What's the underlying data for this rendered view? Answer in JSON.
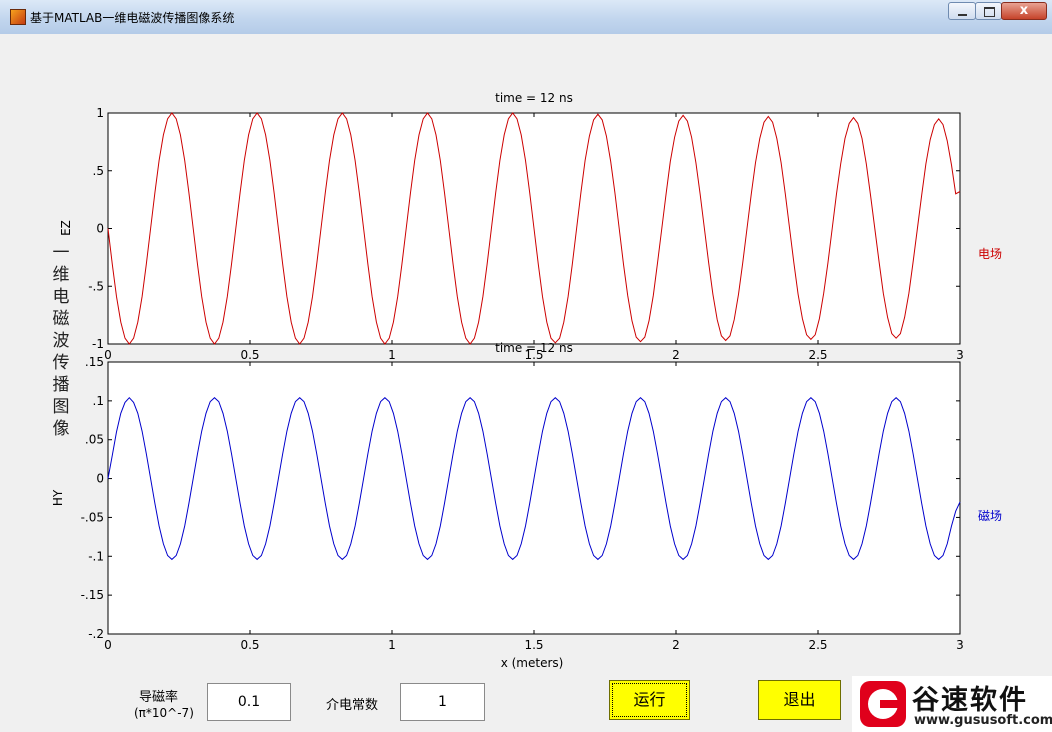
{
  "window": {
    "title": "基于MATLAB一维电磁波传播图像系统",
    "close_glyph": "x"
  },
  "side_title": "一维电磁波传播图像",
  "plots": {
    "ez": {
      "title": "time = 12 ns",
      "ylabel": "EZ",
      "legend_label": "电场",
      "color": "#cc0000"
    },
    "hy": {
      "title": "time = 12 ns",
      "ylabel": "HY",
      "legend_label": "磁场",
      "color": "#0000cc",
      "xlabel": "x (meters)"
    }
  },
  "controls": {
    "mu_label": "导磁率",
    "mu_unit": "(π*10^-7)",
    "mu_value": "0.1",
    "eps_label": "介电常数",
    "eps_value": "1",
    "run_label": "运行",
    "exit_label": "退出"
  },
  "watermark": {
    "name": "谷速软件",
    "url": "www.gususoft.com"
  },
  "chart_data": [
    {
      "type": "line",
      "title": "time = 12 ns",
      "ylabel": "EZ",
      "xlabel": "",
      "xlim": [
        0,
        3
      ],
      "ylim": [
        -1,
        1
      ],
      "xticks": [
        0,
        0.5,
        1,
        1.5,
        2,
        2.5,
        3
      ],
      "yticks": [
        -1,
        -0.5,
        0,
        0.5,
        1
      ],
      "grid": false,
      "legend_position": "right",
      "series": [
        {
          "name": "电场",
          "x": [
            0,
            0.015,
            0.03,
            0.045,
            0.06,
            0.075,
            0.09,
            0.105,
            0.12,
            0.135,
            0.15,
            0.165,
            0.18,
            0.195,
            0.21,
            0.225,
            0.24,
            0.255,
            0.27,
            0.285,
            0.3,
            0.315,
            0.33,
            0.345,
            0.36,
            0.375,
            0.39,
            0.405,
            0.42,
            0.435,
            0.45,
            0.465,
            0.48,
            0.495,
            0.51,
            0.525,
            0.54,
            0.555,
            0.57,
            0.585,
            0.6,
            0.615,
            0.63,
            0.645,
            0.66,
            0.675,
            0.69,
            0.705,
            0.72,
            0.735,
            0.75,
            0.765,
            0.78,
            0.795,
            0.81,
            0.825,
            0.84,
            0.855,
            0.87,
            0.885,
            0.9,
            0.915,
            0.93,
            0.945,
            0.96,
            0.975,
            0.99,
            1.005,
            1.02,
            1.035,
            1.05,
            1.065,
            1.08,
            1.095,
            1.11,
            1.125,
            1.14,
            1.155,
            1.17,
            1.185,
            1.2,
            1.215,
            1.23,
            1.245,
            1.26,
            1.275,
            1.29,
            1.305,
            1.32,
            1.335,
            1.35,
            1.365,
            1.38,
            1.395,
            1.41,
            1.425,
            1.44,
            1.455,
            1.47,
            1.485,
            1.5,
            1.515,
            1.53,
            1.545,
            1.56,
            1.575,
            1.59,
            1.605,
            1.62,
            1.635,
            1.65,
            1.665,
            1.68,
            1.695,
            1.71,
            1.725,
            1.74,
            1.755,
            1.77,
            1.785,
            1.8,
            1.815,
            1.83,
            1.845,
            1.86,
            1.875,
            1.89,
            1.905,
            1.92,
            1.935,
            1.95,
            1.965,
            1.98,
            1.995,
            2.01,
            2.025,
            2.04,
            2.055,
            2.07,
            2.085,
            2.1,
            2.115,
            2.13,
            2.145,
            2.16,
            2.175,
            2.19,
            2.205,
            2.22,
            2.235,
            2.25,
            2.265,
            2.28,
            2.295,
            2.31,
            2.325,
            2.34,
            2.355,
            2.37,
            2.385,
            2.4,
            2.415,
            2.43,
            2.445,
            2.46,
            2.475,
            2.49,
            2.505,
            2.52,
            2.535,
            2.55,
            2.565,
            2.58,
            2.595,
            2.61,
            2.625,
            2.64,
            2.655,
            2.67,
            2.685,
            2.7,
            2.715,
            2.73,
            2.745,
            2.76,
            2.775,
            2.79,
            2.805,
            2.82,
            2.835,
            2.85,
            2.865,
            2.88,
            2.895,
            2.91,
            2.925,
            2.94,
            2.955,
            2.97,
            2.985,
            3.0
          ],
          "values": [
            0.0,
            -0.31,
            -0.59,
            -0.81,
            -0.95,
            -1.0,
            -0.95,
            -0.81,
            -0.59,
            -0.31,
            0.0,
            0.31,
            0.59,
            0.81,
            0.95,
            1.0,
            0.95,
            0.81,
            0.59,
            0.31,
            0.0,
            -0.31,
            -0.59,
            -0.81,
            -0.95,
            -1.0,
            -0.95,
            -0.81,
            -0.59,
            -0.31,
            0.0,
            0.31,
            0.59,
            0.81,
            0.95,
            1.0,
            0.95,
            0.81,
            0.59,
            0.31,
            0.0,
            -0.31,
            -0.59,
            -0.81,
            -0.95,
            -1.0,
            -0.95,
            -0.81,
            -0.59,
            -0.31,
            0.0,
            0.31,
            0.59,
            0.81,
            0.95,
            1.0,
            0.95,
            0.81,
            0.59,
            0.31,
            0.0,
            -0.31,
            -0.59,
            -0.81,
            -0.95,
            -1.0,
            -0.95,
            -0.81,
            -0.59,
            -0.31,
            0.0,
            0.31,
            0.59,
            0.81,
            0.95,
            1.0,
            0.95,
            0.81,
            0.59,
            0.31,
            0.0,
            -0.31,
            -0.59,
            -0.81,
            -0.95,
            -1.0,
            -0.95,
            -0.81,
            -0.59,
            -0.31,
            0.0,
            0.31,
            0.59,
            0.81,
            0.95,
            1.0,
            0.95,
            0.81,
            0.59,
            0.31,
            0.0,
            -0.31,
            -0.59,
            -0.81,
            -0.95,
            -0.99,
            -0.95,
            -0.81,
            -0.59,
            -0.31,
            0.0,
            0.31,
            0.59,
            0.8,
            0.94,
            0.99,
            0.94,
            0.8,
            0.58,
            0.31,
            0.0,
            -0.31,
            -0.58,
            -0.8,
            -0.94,
            -0.98,
            -0.94,
            -0.8,
            -0.58,
            -0.3,
            0.0,
            0.3,
            0.58,
            0.79,
            0.93,
            0.98,
            0.93,
            0.79,
            0.57,
            0.3,
            0.0,
            -0.3,
            -0.57,
            -0.79,
            -0.93,
            -0.97,
            -0.93,
            -0.79,
            -0.57,
            -0.3,
            0.0,
            0.3,
            0.57,
            0.78,
            0.92,
            0.97,
            0.92,
            0.78,
            0.57,
            0.3,
            0.0,
            -0.3,
            -0.57,
            -0.78,
            -0.92,
            -0.96,
            -0.92,
            -0.78,
            -0.56,
            -0.3,
            0.0,
            0.3,
            0.56,
            0.78,
            0.91,
            0.96,
            0.91,
            0.78,
            0.56,
            0.29,
            0.0,
            -0.29,
            -0.56,
            -0.77,
            -0.91,
            -0.95,
            -0.91,
            -0.77,
            -0.56,
            -0.29,
            0.0,
            0.29,
            0.56,
            0.77,
            0.9,
            0.95,
            0.9,
            0.76,
            0.55,
            0.3,
            0.32
          ]
        }
      ]
    },
    {
      "type": "line",
      "title": "time = 12 ns",
      "ylabel": "HY",
      "xlabel": "x (meters)",
      "xlim": [
        0,
        3
      ],
      "ylim": [
        -0.2,
        0.15
      ],
      "xticks": [
        0,
        0.5,
        1,
        1.5,
        2,
        2.5,
        3
      ],
      "yticks": [
        -0.2,
        -0.15,
        -0.1,
        -0.05,
        0,
        0.05,
        0.1,
        0.15
      ],
      "grid": false,
      "legend_position": "right",
      "series": [
        {
          "name": "磁场",
          "x": [
            0,
            0.015,
            0.03,
            0.045,
            0.06,
            0.075,
            0.09,
            0.105,
            0.12,
            0.135,
            0.15,
            0.165,
            0.18,
            0.195,
            0.21,
            0.225,
            0.24,
            0.255,
            0.27,
            0.285,
            0.3,
            0.315,
            0.33,
            0.345,
            0.36,
            0.375,
            0.39,
            0.405,
            0.42,
            0.435,
            0.45,
            0.465,
            0.48,
            0.495,
            0.51,
            0.525,
            0.54,
            0.555,
            0.57,
            0.585,
            0.6,
            0.615,
            0.63,
            0.645,
            0.66,
            0.675,
            0.69,
            0.705,
            0.72,
            0.735,
            0.75,
            0.765,
            0.78,
            0.795,
            0.81,
            0.825,
            0.84,
            0.855,
            0.87,
            0.885,
            0.9,
            0.915,
            0.93,
            0.945,
            0.96,
            0.975,
            0.99,
            1.005,
            1.02,
            1.035,
            1.05,
            1.065,
            1.08,
            1.095,
            1.11,
            1.125,
            1.14,
            1.155,
            1.17,
            1.185,
            1.2,
            1.215,
            1.23,
            1.245,
            1.26,
            1.275,
            1.29,
            1.305,
            1.32,
            1.335,
            1.35,
            1.365,
            1.38,
            1.395,
            1.41,
            1.425,
            1.44,
            1.455,
            1.47,
            1.485,
            1.5,
            1.515,
            1.53,
            1.545,
            1.56,
            1.575,
            1.59,
            1.605,
            1.62,
            1.635,
            1.65,
            1.665,
            1.68,
            1.695,
            1.71,
            1.725,
            1.74,
            1.755,
            1.77,
            1.785,
            1.8,
            1.815,
            1.83,
            1.845,
            1.86,
            1.875,
            1.89,
            1.905,
            1.92,
            1.935,
            1.95,
            1.965,
            1.98,
            1.995,
            2.01,
            2.025,
            2.04,
            2.055,
            2.07,
            2.085,
            2.1,
            2.115,
            2.13,
            2.145,
            2.16,
            2.175,
            2.19,
            2.205,
            2.22,
            2.235,
            2.25,
            2.265,
            2.28,
            2.295,
            2.31,
            2.325,
            2.34,
            2.355,
            2.37,
            2.385,
            2.4,
            2.415,
            2.43,
            2.445,
            2.46,
            2.475,
            2.49,
            2.505,
            2.52,
            2.535,
            2.55,
            2.565,
            2.58,
            2.595,
            2.61,
            2.625,
            2.64,
            2.655,
            2.67,
            2.685,
            2.7,
            2.715,
            2.73,
            2.745,
            2.76,
            2.775,
            2.79,
            2.805,
            2.82,
            2.835,
            2.85,
            2.865,
            2.88,
            2.895,
            2.91,
            2.925,
            2.94,
            2.955,
            2.97,
            2.985,
            3.0
          ],
          "values": [
            0.0,
            0.03,
            0.06,
            0.084,
            0.098,
            0.104,
            0.098,
            0.084,
            0.061,
            0.032,
            0.0,
            -0.032,
            -0.061,
            -0.084,
            -0.099,
            -0.104,
            -0.099,
            -0.084,
            -0.061,
            -0.032,
            0.0,
            0.032,
            0.061,
            0.084,
            0.099,
            0.104,
            0.099,
            0.084,
            0.061,
            0.032,
            0.0,
            -0.032,
            -0.061,
            -0.084,
            -0.099,
            -0.104,
            -0.099,
            -0.084,
            -0.061,
            -0.032,
            0.0,
            0.032,
            0.061,
            0.084,
            0.099,
            0.104,
            0.099,
            0.084,
            0.061,
            0.032,
            0.0,
            -0.032,
            -0.061,
            -0.084,
            -0.099,
            -0.104,
            -0.099,
            -0.084,
            -0.061,
            -0.032,
            0.0,
            0.032,
            0.061,
            0.084,
            0.099,
            0.104,
            0.099,
            0.084,
            0.061,
            0.032,
            0.0,
            -0.032,
            -0.061,
            -0.084,
            -0.099,
            -0.104,
            -0.099,
            -0.084,
            -0.061,
            -0.032,
            0.0,
            0.032,
            0.061,
            0.084,
            0.099,
            0.104,
            0.099,
            0.084,
            0.061,
            0.032,
            0.0,
            -0.032,
            -0.061,
            -0.084,
            -0.099,
            -0.104,
            -0.099,
            -0.084,
            -0.061,
            -0.032,
            0.0,
            0.032,
            0.061,
            0.084,
            0.099,
            0.104,
            0.099,
            0.084,
            0.061,
            0.032,
            0.0,
            -0.032,
            -0.061,
            -0.084,
            -0.099,
            -0.104,
            -0.099,
            -0.084,
            -0.061,
            -0.032,
            0.0,
            0.032,
            0.061,
            0.084,
            0.099,
            0.104,
            0.099,
            0.084,
            0.061,
            0.032,
            0.0,
            -0.032,
            -0.061,
            -0.084,
            -0.099,
            -0.104,
            -0.099,
            -0.084,
            -0.061,
            -0.032,
            0.0,
            0.032,
            0.061,
            0.084,
            0.099,
            0.104,
            0.099,
            0.084,
            0.061,
            0.032,
            0.0,
            -0.032,
            -0.061,
            -0.084,
            -0.099,
            -0.104,
            -0.099,
            -0.084,
            -0.061,
            -0.032,
            0.0,
            0.032,
            0.061,
            0.084,
            0.099,
            0.104,
            0.099,
            0.084,
            0.061,
            0.032,
            0.0,
            -0.032,
            -0.061,
            -0.084,
            -0.099,
            -0.104,
            -0.099,
            -0.084,
            -0.061,
            -0.032,
            0.0,
            0.032,
            0.061,
            0.084,
            0.099,
            0.104,
            0.099,
            0.084,
            0.061,
            0.032,
            0.0,
            -0.032,
            -0.061,
            -0.084,
            -0.099,
            -0.104,
            -0.099,
            -0.084,
            -0.061,
            -0.042,
            -0.03
          ]
        }
      ]
    }
  ]
}
